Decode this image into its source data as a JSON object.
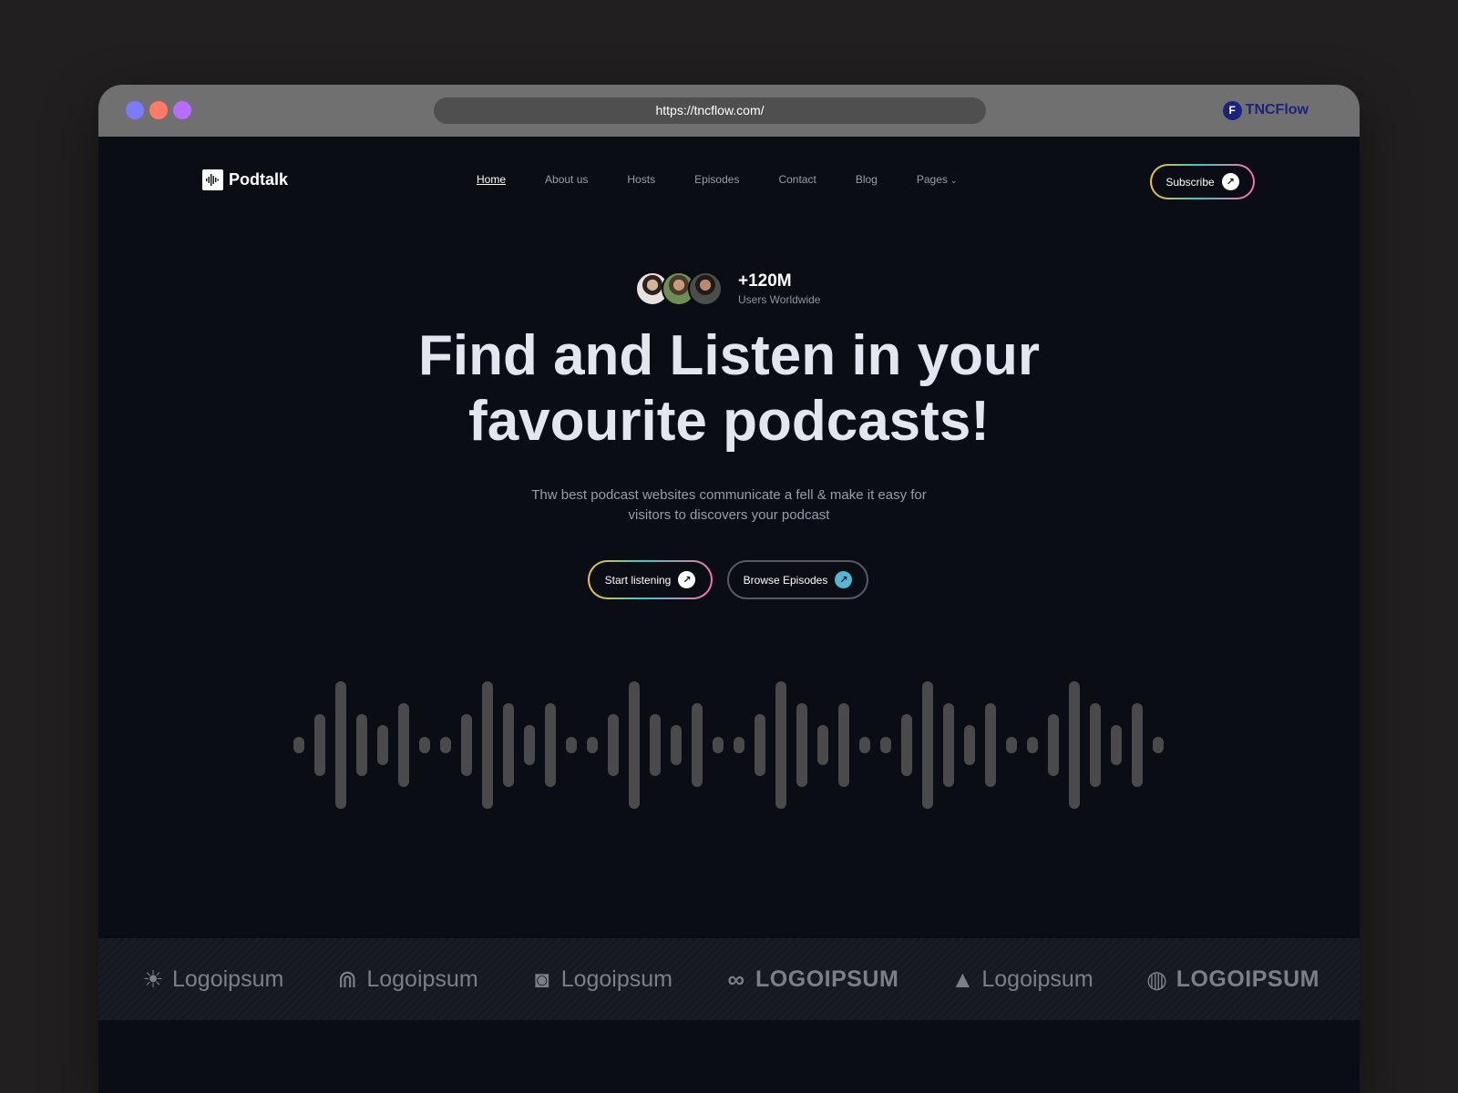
{
  "browser": {
    "url": "https://tncflow.com/",
    "brand_badge": "F",
    "brand_name": "TNCFlow"
  },
  "header": {
    "logo_text": "Podtalk",
    "nav": [
      "Home",
      "About us",
      "Hosts",
      "Episodes",
      "Contact",
      "Blog",
      "Pages"
    ],
    "subscribe_label": "Subscribe"
  },
  "hero": {
    "users_count": "+120M",
    "users_label": "Users Worldwide",
    "title_line1": "Find and Listen in your",
    "title_line2": "favourite podcasts!",
    "subtitle_line1": "Thw best podcast websites communicate a fell & make it easy for",
    "subtitle_line2": "visitors to discovers your podcast",
    "primary_cta": "Start listening",
    "secondary_cta": "Browse Episodes",
    "arrow_glyph": "↗"
  },
  "partners": {
    "items": [
      {
        "name": "Logoipsum",
        "icon": "sun-logo-icon",
        "caps": false
      },
      {
        "name": "Logoipsum",
        "icon": "arch-logo-icon",
        "caps": false
      },
      {
        "name": "Logoipsum",
        "icon": "circle-square-logo-icon",
        "caps": false
      },
      {
        "name": "LOGOIPSUM",
        "icon": "infinity-logo-icon",
        "caps": true
      },
      {
        "name": "Logoipsum",
        "icon": "triangle-logo-icon",
        "caps": false
      },
      {
        "name": "LOGOIPSUM",
        "icon": "swirl-logo-icon",
        "caps": true
      }
    ]
  },
  "colors": {
    "background": "#0b0d15",
    "wave_bar": "#4a4a4a",
    "gradient": [
      "#f4c430",
      "#3fc6c6",
      "#ff6fa8"
    ],
    "browse_arrow": "#55b6d4"
  }
}
